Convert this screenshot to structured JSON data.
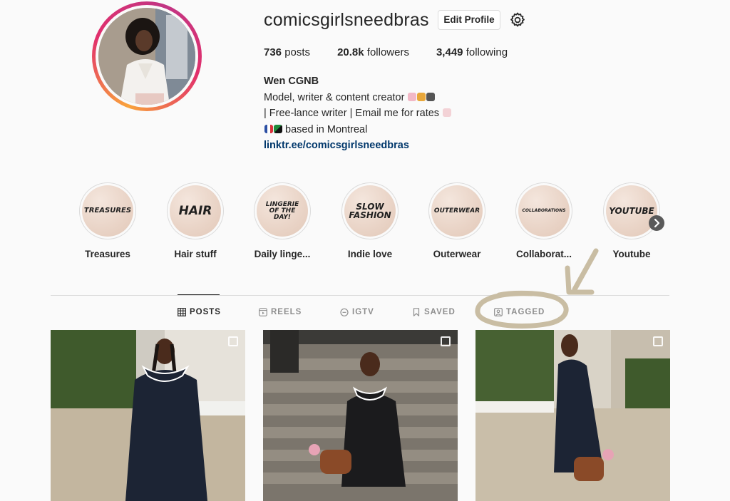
{
  "profile": {
    "username": "comicsgirlsneedbras",
    "edit_label": "Edit Profile",
    "posts_count": "736",
    "posts_label": "posts",
    "followers_count": "20.8k",
    "followers_label": "followers",
    "following_count": "3,449",
    "following_label": "following",
    "name": "Wen CGNB",
    "bio_line1": "Model, writer & content creator",
    "bio_line2": "| Free-lance writer | Email me for rates",
    "bio_line3": "based in Montreal",
    "link": "linktr.ee/comicsgirlsneedbras"
  },
  "highlights": [
    {
      "cover": "TREASURES",
      "label": "Treasures"
    },
    {
      "cover": "HAIR",
      "label": "Hair stuff"
    },
    {
      "cover": "LINGERIE OF THE DAY!",
      "label": "Daily linge..."
    },
    {
      "cover": "SLOW FASHION",
      "label": "Indie love"
    },
    {
      "cover": "OUTERWEAR",
      "label": "Outerwear"
    },
    {
      "cover": "COLLABORATIONS",
      "label": "Collaborat..."
    },
    {
      "cover": "YOUTUBE",
      "label": "Youtube"
    }
  ],
  "tabs": [
    {
      "label": "POSTS",
      "icon": "grid-icon"
    },
    {
      "label": "REELS",
      "icon": "reels-icon"
    },
    {
      "label": "IGTV",
      "icon": "igtv-icon"
    },
    {
      "label": "SAVED",
      "icon": "bookmark-icon"
    },
    {
      "label": "TAGGED",
      "icon": "tagged-icon"
    }
  ],
  "colors": {
    "link": "#00376b",
    "annotation": "#c9bda3",
    "highlight_cover": "#ead5c8"
  }
}
